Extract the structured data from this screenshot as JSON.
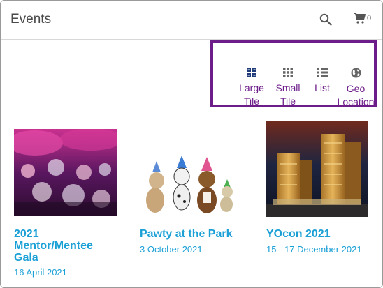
{
  "header": {
    "title": "Events",
    "cart_count": "0"
  },
  "view_options": [
    {
      "label": "Large\nTile",
      "icon": "large-tile-icon"
    },
    {
      "label": "Small\nTile",
      "icon": "small-tile-icon"
    },
    {
      "label": "List",
      "icon": "list-icon"
    },
    {
      "label": "Geo\nLocation",
      "icon": "globe-icon"
    }
  ],
  "events": [
    {
      "title": "2021\nMentor/Mentee\nGala",
      "date": "16 April 2021"
    },
    {
      "title": "Pawty at the Park",
      "date": "3 October 2021"
    },
    {
      "title": "YOcon 2021",
      "date": "15 - 17 December 2021"
    }
  ],
  "colors": {
    "accent_purple": "#6d1d8a",
    "link_blue": "#1ba0d6",
    "title_gray": "#4a4a4a"
  }
}
